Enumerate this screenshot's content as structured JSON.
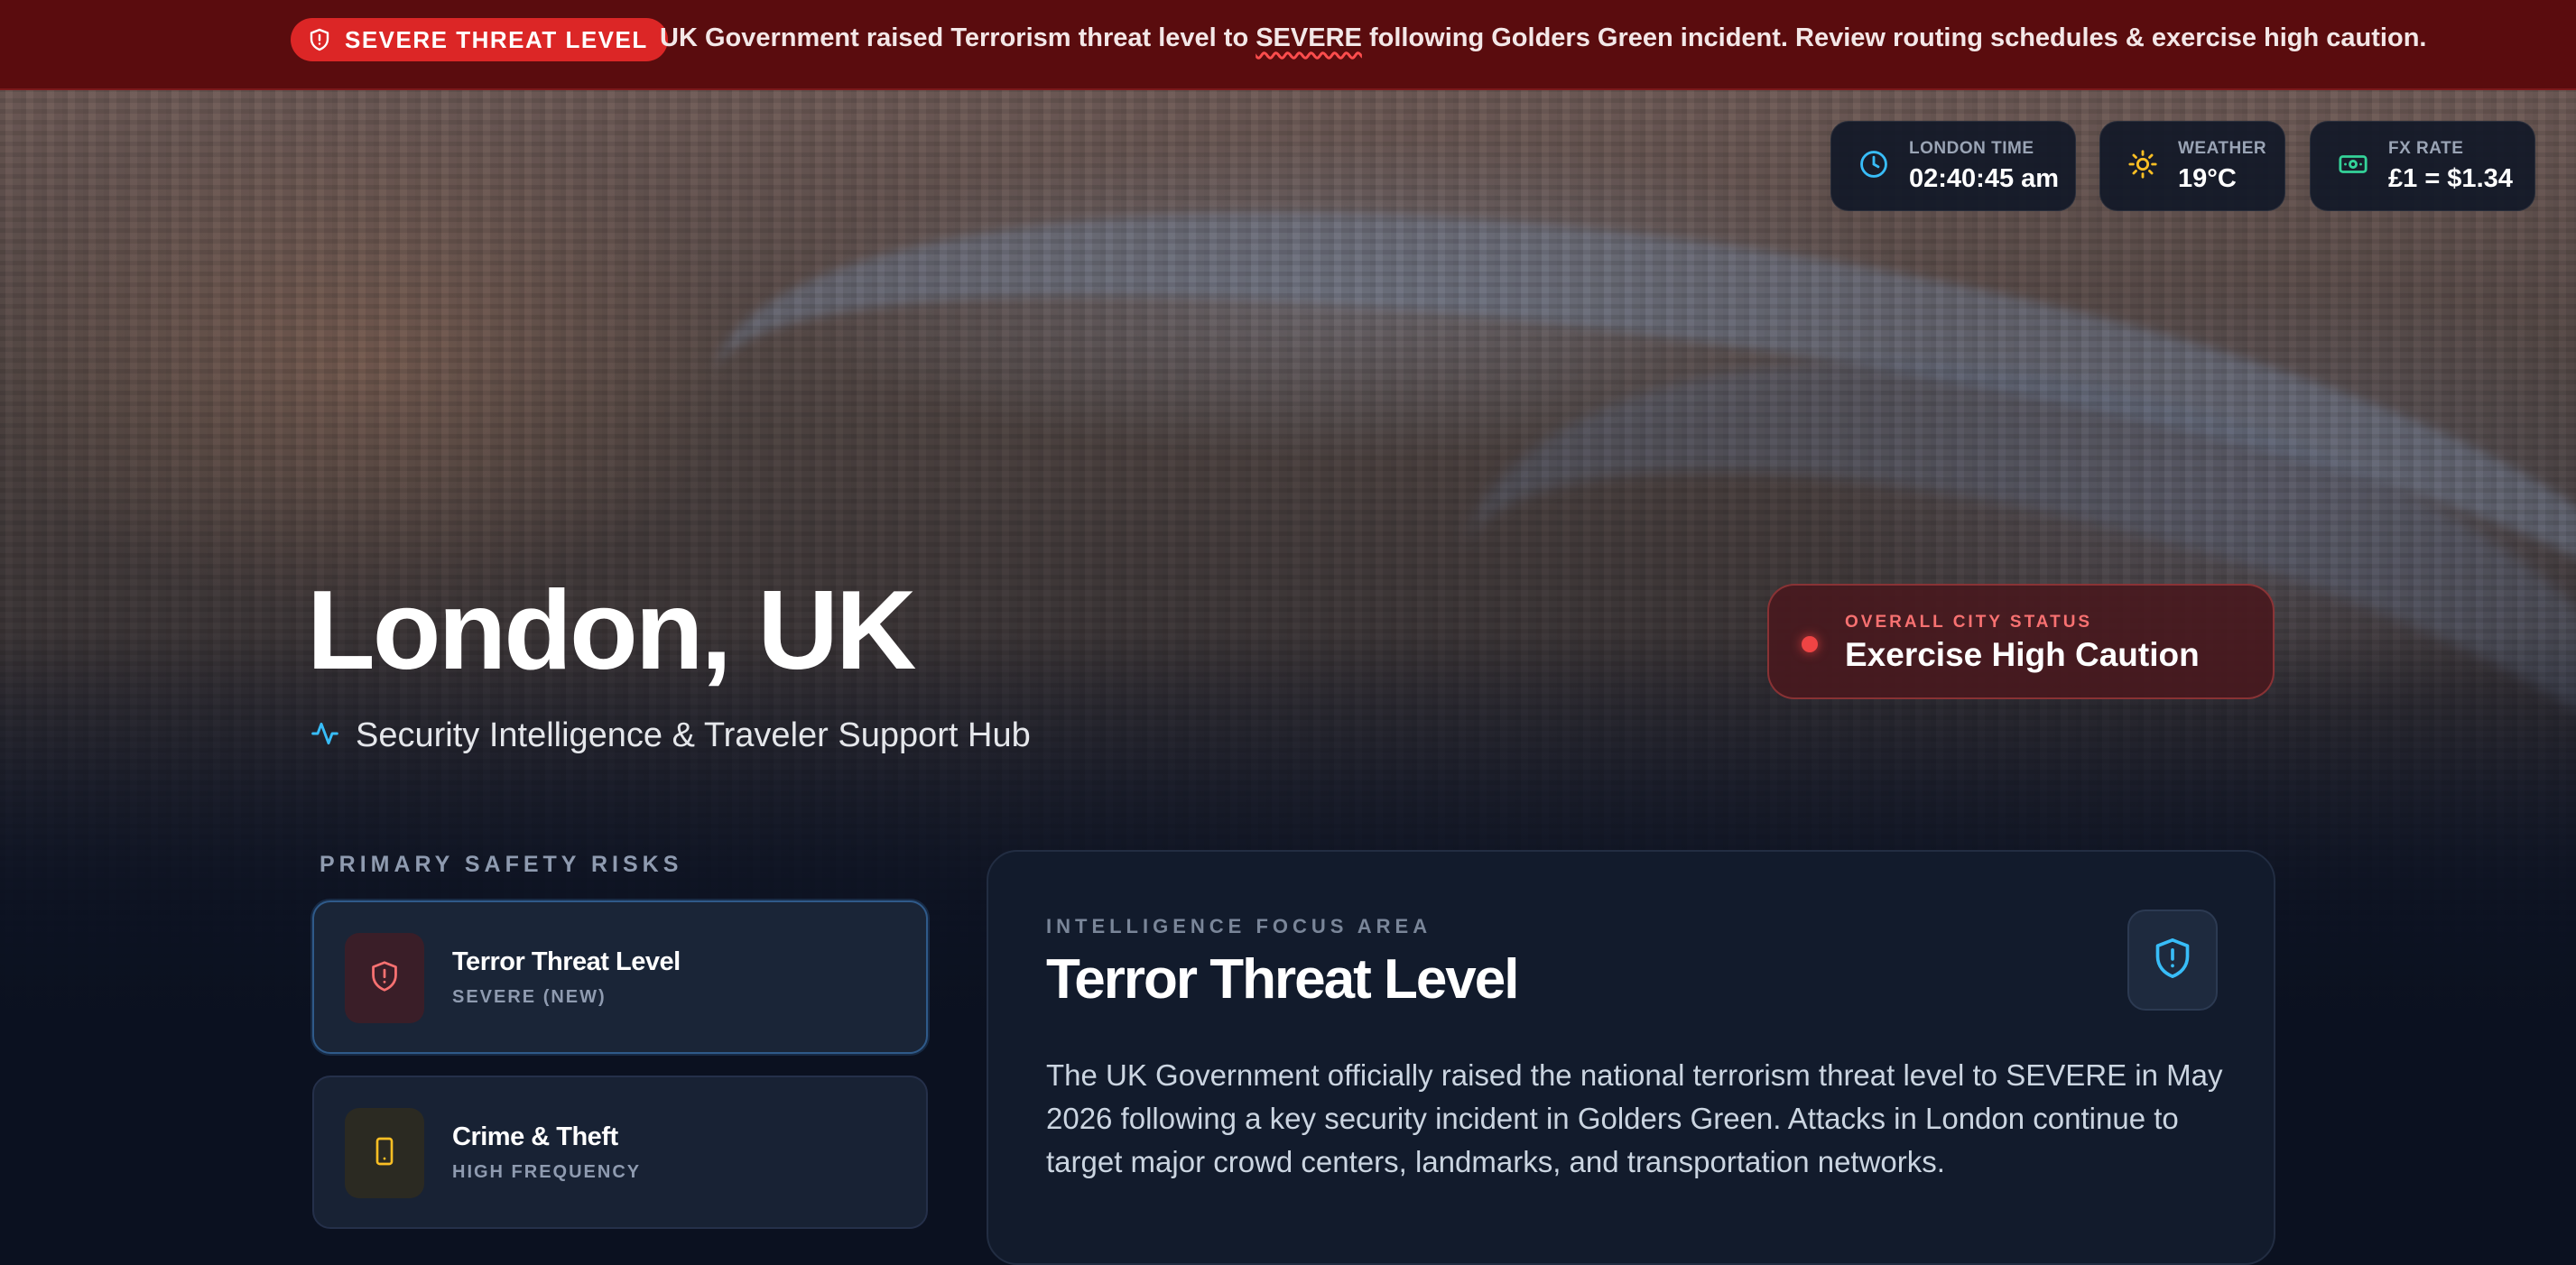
{
  "alert": {
    "badge": "SEVERE THREAT LEVEL",
    "message_before": "UK Government raised Terrorism threat level to ",
    "message_highlight": "SEVERE",
    "message_after": " following Golders Green incident. Review routing schedules & exercise high caution."
  },
  "chips": {
    "time": {
      "label": "LONDON TIME",
      "value": "02:40:45 am",
      "icon": "clock-icon"
    },
    "weather": {
      "label": "WEATHER",
      "value": "19°C",
      "icon": "sun-icon"
    },
    "fx": {
      "label": "FX RATE",
      "value": "£1 = $1.34",
      "icon": "banknote-icon"
    }
  },
  "hero": {
    "title": "London, UK",
    "subtitle": "Security Intelligence & Traveler Support Hub"
  },
  "status": {
    "label": "OVERALL CITY STATUS",
    "value": "Exercise High Caution"
  },
  "risks": {
    "heading": "PRIMARY SAFETY RISKS",
    "items": [
      {
        "title": "Terror Threat Level",
        "subtitle": "SEVERE (NEW)",
        "icon": "shield-alert-icon"
      },
      {
        "title": "Crime & Theft",
        "subtitle": "HIGH FREQUENCY",
        "icon": "smartphone-icon"
      }
    ]
  },
  "focus": {
    "label": "INTELLIGENCE FOCUS AREA",
    "title": "Terror Threat Level",
    "body": "The UK Government officially raised the national terrorism threat level to SEVERE in May 2026 following a key security incident in Golders Green. Attacks in London continue to target major crowd centers, landmarks, and transportation networks."
  },
  "colors": {
    "alert_bg": "#5a0c0e",
    "alert_badge": "#dc2626",
    "accent_blue": "#38bdf8",
    "caution_red": "#ef4444"
  }
}
